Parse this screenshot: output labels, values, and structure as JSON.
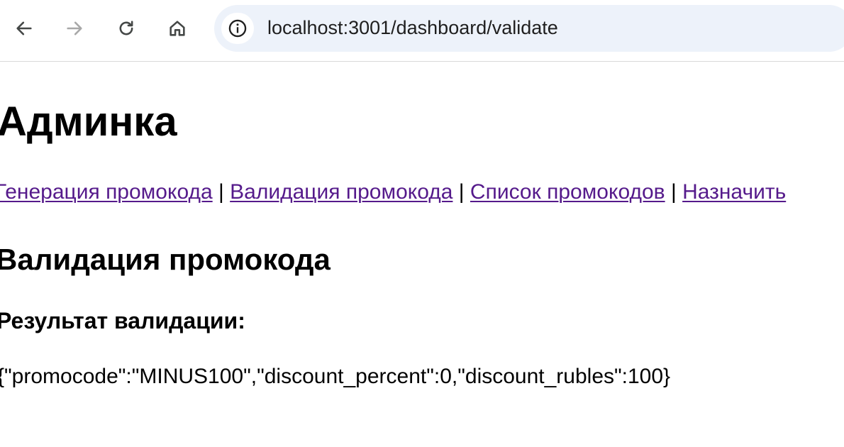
{
  "browser": {
    "url": "localhost:3001/dashboard/validate",
    "icons": {
      "back": "back-arrow-icon",
      "forward": "forward-arrow-icon",
      "reload": "reload-icon",
      "home": "home-icon",
      "site_info": "info-icon"
    }
  },
  "page": {
    "title": "Админка",
    "nav": [
      {
        "label": "Генерация промокода"
      },
      {
        "label": "Валидация промокода"
      },
      {
        "label": "Список промокодов"
      },
      {
        "label": "Назначить"
      }
    ],
    "separator": "|",
    "section_title": "Валидация промокода",
    "result_heading": "Результат валидации:",
    "result_text": "{\"promocode\":\"MINUS100\",\"discount_percent\":0,\"discount_rubles\":100}"
  },
  "colors": {
    "link_visited": "#551a8b",
    "omnibox_bg": "#edf2fa",
    "forward_disabled": "#a8a8a8"
  }
}
